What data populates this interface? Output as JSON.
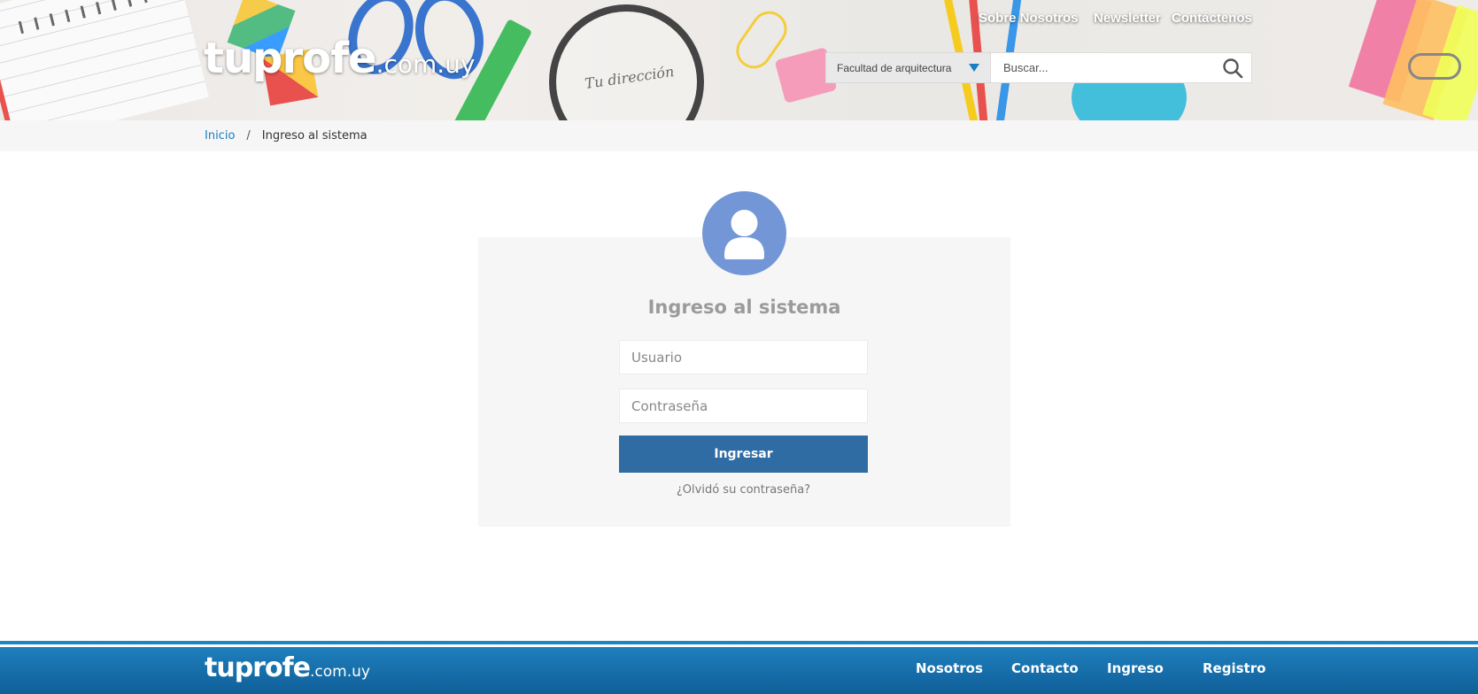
{
  "header": {
    "logo_main": "tuprofe",
    "logo_tld": ".com.uy",
    "background_text": "Tu dirección",
    "nav": [
      {
        "label": "Sobre Nosotros"
      },
      {
        "label": "Newsletter"
      },
      {
        "label": "Contáctenos"
      }
    ],
    "faculty_select": {
      "value": "Facultad de arquitectura"
    },
    "search": {
      "placeholder": "Buscar...",
      "value": ""
    }
  },
  "breadcrumb": {
    "home": "Inicio",
    "separator": "/",
    "current": "Ingreso al sistema"
  },
  "login": {
    "title": "Ingreso al sistema",
    "username_placeholder": "Usuario",
    "password_placeholder": "Contraseña",
    "submit_label": "Ingresar",
    "forgot_label": "¿Olvidó su contraseña?"
  },
  "footer": {
    "logo_main": "tuprofe",
    "logo_tld": ".com.uy",
    "links": [
      {
        "label": "Nosotros"
      },
      {
        "label": "Contacto"
      },
      {
        "label": "Ingreso"
      },
      {
        "label": "Registro"
      }
    ]
  },
  "colors": {
    "accent_blue": "#1a7fc1",
    "button_blue": "#306ca4",
    "avatar_blue": "#7396d6",
    "footer_blue": "#0f5f98"
  },
  "icons": {
    "search": "search-icon",
    "dropdown": "chevron-down-icon",
    "avatar": "user-avatar-icon"
  }
}
